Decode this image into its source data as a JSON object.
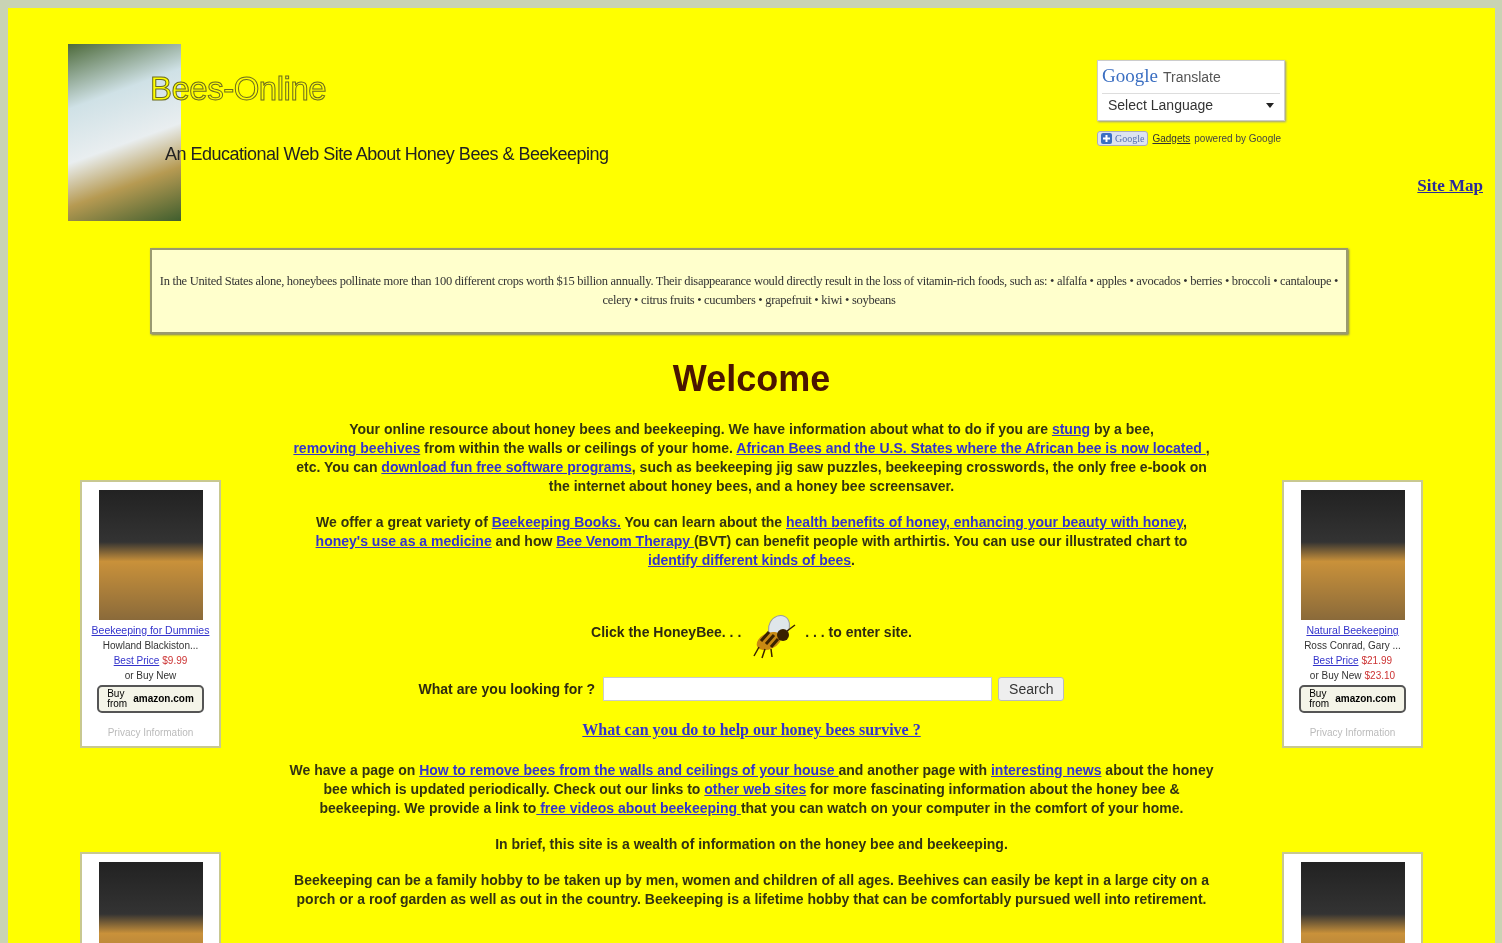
{
  "header": {
    "site_title": "Bees-Online",
    "tagline": "An Educational Web Site About Honey Bees & Beekeeping",
    "translate": {
      "brand": "Google",
      "label": "Translate",
      "select": "Select Language"
    },
    "gadgets": {
      "brand": "Google",
      "link": "Gadgets",
      "text": "powered by Google"
    },
    "site_map": "Site Map"
  },
  "fact_box": "In the United States alone, honeybees pollinate more than 100 different crops worth $15 billion annually. Their disappearance would directly result in the loss of vitamin-rich foods, such as: • alfalfa • apples • avocados • berries • broccoli • cantaloupe • celery • citrus fruits • cucumbers • grapefruit • kiwi • soybeans",
  "content": [
    {
      "kind": "heading",
      "text": "Welcome"
    },
    {
      "kind": "paragraph",
      "segments": [
        {
          "text": "Your online resource about honey bees and beekeeping. We have information about what to do if you are ",
          "link": false
        },
        {
          "text": "stung",
          "link": true
        },
        {
          "text": " by a bee, ",
          "link": false
        },
        {
          "text": "removing beehives",
          "link": true
        },
        {
          "text": " from within the walls or ceilings of your home. ",
          "link": false
        },
        {
          "text": "African Bees and the U.S. States where the African bee is now located ",
          "link": true
        },
        {
          "text": ", etc. You can ",
          "link": false
        },
        {
          "text": "download fun free software programs",
          "link": true
        },
        {
          "text": ", such as beekeeping jig saw puzzles, beekeeping crosswords, the only free e-book on the internet about honey bees, and a honey bee screensaver.",
          "link": false
        }
      ]
    },
    {
      "kind": "paragraph",
      "segments": [
        {
          "text": "We offer a great variety of ",
          "link": false
        },
        {
          "text": "Beekeeping Books.",
          "link": true
        },
        {
          "text": " You can learn about the ",
          "link": false
        },
        {
          "text": "health benefits of honey, enhancing your beauty with honey",
          "link": true
        },
        {
          "text": ", ",
          "link": false
        },
        {
          "text": "honey's use as a medicine",
          "link": true
        },
        {
          "text": " and how ",
          "link": false
        },
        {
          "text": "Bee Venom Therapy ",
          "link": true
        },
        {
          "text": "(BVT) can benefit people with arthirtis. You can use our illustrated chart to ",
          "link": false
        },
        {
          "text": "identify different kinds of bees",
          "link": true
        },
        {
          "text": ".",
          "link": false
        }
      ]
    },
    {
      "kind": "enter_prompt",
      "before": "Click the HoneyBee. . .",
      "after": ". . . to enter site."
    },
    {
      "kind": "search",
      "label": "What are you looking for ?",
      "button": "Search"
    },
    {
      "kind": "help_link",
      "text": "What can you do to help our honey bees survive ?"
    },
    {
      "kind": "paragraph",
      "segments": [
        {
          "text": "We have a page on ",
          "link": false
        },
        {
          "text": "How to remove bees from the walls and ceilings of your house ",
          "link": true
        },
        {
          "text": "and another page with ",
          "link": false
        },
        {
          "text": "interesting news",
          "link": true
        },
        {
          "text": " about the honey bee which is updated periodically. Check out our links to ",
          "link": false
        },
        {
          "text": "other web sites",
          "link": true
        },
        {
          "text": " for more fascinating information about the honey bee & beekeeping. We provide a link to",
          "link": false
        },
        {
          "text": " free videos about beekeeping ",
          "link": true
        },
        {
          "text": "that you can watch on your computer in the comfort of your home.",
          "link": false
        }
      ]
    },
    {
      "kind": "paragraph",
      "segments": [
        {
          "text": "In brief, this site is a wealth of information on the honey bee and beekeeping.",
          "link": false
        }
      ]
    },
    {
      "kind": "paragraph",
      "segments": [
        {
          "text": "Beekeeping can be a family hobby to be taken up by men, women and children of all ages. Beehives can easily be kept in a large city on a porch or a roof garden as well as out in the country. Beekeeping is a lifetime hobby that can be comfortably pursued well into retirement.",
          "link": false
        }
      ]
    }
  ],
  "left_ads": [
    {
      "kind": "book",
      "title": "Beekeeping for Dummies",
      "author": "Howland Blackiston...",
      "best_price_label": "Best Price",
      "best_price": "$9.99",
      "buy_new_label": "or Buy New",
      "buy_button": "Buy from",
      "buy_store": "amazon.com",
      "privacy": "Privacy Information"
    },
    {
      "kind": "cover_only"
    }
  ],
  "right_ads": [
    {
      "kind": "book",
      "title": "Natural Beekeeping",
      "author": "Ross Conrad, Gary ...",
      "best_price_label": "Best Price",
      "best_price": "$21.99",
      "buy_new_label": "or Buy New",
      "buy_new_price": "$23.10",
      "buy_button": "Buy from",
      "buy_store": "amazon.com",
      "privacy": "Privacy Information"
    },
    {
      "kind": "cover_only"
    }
  ]
}
